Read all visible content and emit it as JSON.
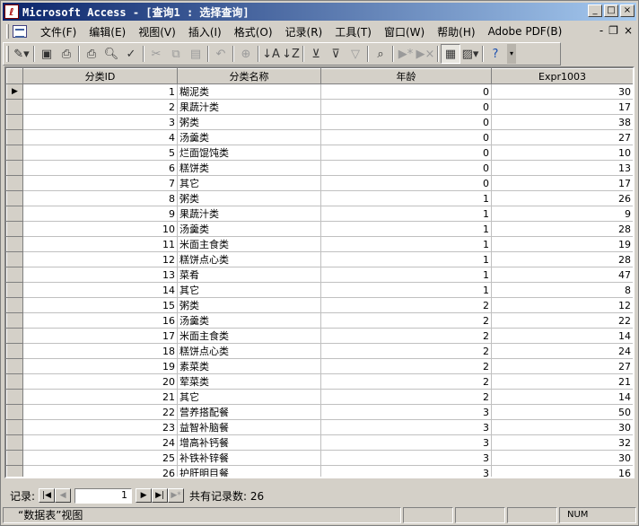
{
  "window": {
    "title": "Microsoft Access - [查询1 : 选择查询]",
    "min_label": "_",
    "max_label": "□",
    "close_label": "×"
  },
  "menu": {
    "items": [
      "文件(F)",
      "编辑(E)",
      "视图(V)",
      "插入(I)",
      "格式(O)",
      "记录(R)",
      "工具(T)",
      "窗口(W)",
      "帮助(H)",
      "Adobe PDF(B)"
    ],
    "mdi_min": "-",
    "mdi_restore": "❐",
    "mdi_close": "×"
  },
  "toolbar": {
    "icons": [
      "view-icon",
      "save-icon",
      "print-preview-icon",
      "print-icon",
      "preview-icon",
      "spelling-icon",
      "cut-icon",
      "copy-icon",
      "paste-icon",
      "undo-icon",
      "hyperlink-icon",
      "sort-asc-icon",
      "sort-desc-icon",
      "filter-selection-icon",
      "filter-form-icon",
      "apply-filter-icon",
      "find-icon",
      "new-record-icon",
      "delete-record-icon",
      "database-window-icon",
      "new-object-icon",
      "help-icon"
    ]
  },
  "grid": {
    "columns": [
      "分类ID",
      "分类名称",
      "年龄",
      "Expr1003"
    ],
    "rows": [
      [
        "1",
        "糊泥类",
        "0",
        "30"
      ],
      [
        "2",
        "果蔬汁类",
        "0",
        "17"
      ],
      [
        "3",
        "粥类",
        "0",
        "38"
      ],
      [
        "4",
        "汤羹类",
        "0",
        "27"
      ],
      [
        "5",
        "烂面馄饨类",
        "0",
        "10"
      ],
      [
        "6",
        "糕饼类",
        "0",
        "13"
      ],
      [
        "7",
        "其它",
        "0",
        "17"
      ],
      [
        "8",
        "粥类",
        "1",
        "26"
      ],
      [
        "9",
        "果蔬汁类",
        "1",
        "9"
      ],
      [
        "10",
        "汤羹类",
        "1",
        "28"
      ],
      [
        "11",
        "米面主食类",
        "1",
        "19"
      ],
      [
        "12",
        "糕饼点心类",
        "1",
        "28"
      ],
      [
        "13",
        "菜肴",
        "1",
        "47"
      ],
      [
        "14",
        "其它",
        "1",
        "8"
      ],
      [
        "15",
        "粥类",
        "2",
        "12"
      ],
      [
        "16",
        "汤羹类",
        "2",
        "22"
      ],
      [
        "17",
        "米面主食类",
        "2",
        "14"
      ],
      [
        "18",
        "糕饼点心类",
        "2",
        "24"
      ],
      [
        "19",
        "素菜类",
        "2",
        "27"
      ],
      [
        "20",
        "荤菜类",
        "2",
        "21"
      ],
      [
        "21",
        "其它",
        "2",
        "14"
      ],
      [
        "22",
        "营养搭配餐",
        "3",
        "50"
      ],
      [
        "23",
        "益智补脑餐",
        "3",
        "30"
      ],
      [
        "24",
        "增高补钙餐",
        "3",
        "32"
      ],
      [
        "25",
        "补铁补锌餐",
        "3",
        "30"
      ],
      [
        "26",
        "护肝明目餐",
        "3",
        "16"
      ]
    ]
  },
  "recnav": {
    "label": "记录:",
    "current": "1",
    "total": "共有记录数: 26"
  },
  "status": {
    "view": "“数据表”视图",
    "num": "NUM"
  }
}
